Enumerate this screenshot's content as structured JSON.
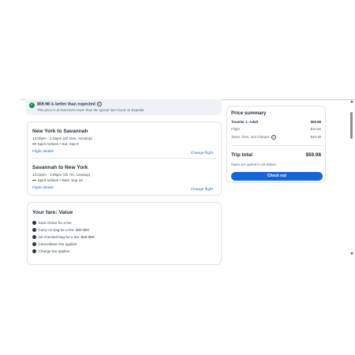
{
  "banner": {
    "title": "$59.98 is better than expected",
    "info_icon": "i",
    "subtitle": "This price is at least 82% lower than the typical fare found on Expedia",
    "check_icon": "✓",
    "color": "#1b8a4a"
  },
  "flights": [
    {
      "route": "New York to Savannah",
      "time": "12:00pm - 2:15pm (2h 15m, nonstop)",
      "airline": "Spirit Airlines • Sat, Sep 6",
      "details_link": "Flight details",
      "change_link": "Change flight"
    },
    {
      "route": "Savannah to New York",
      "time": "12:02pm - 2:09pm (2h 7m, nonstop)",
      "airline": "Spirit Airlines • Wed, Sep 10",
      "details_link": "Flight details",
      "change_link": "Change flight"
    }
  ],
  "fare": {
    "title": "Your fare: Value",
    "items": [
      "Seat choice for a fee",
      "Carry-on bag for a fee: $65-$99",
      "1st checked bag for a fee: $55-$99",
      "Cancellation fee applies",
      "Change fee applies"
    ]
  },
  "price_summary": {
    "title": "Price summary",
    "traveler_label": "Traveler 1: Adult",
    "traveler_value": "$59.98",
    "flight_label": "Flight",
    "flight_value": "$10.60",
    "taxes_label": "Taxes, fees, and charges",
    "taxes_value": "$49.38",
    "total_label": "Trip total",
    "total_value": "$59.98",
    "rates_note": "Rates are quoted in US dollars",
    "checkout_label": "Check out",
    "accent_color": "#1565d8"
  }
}
